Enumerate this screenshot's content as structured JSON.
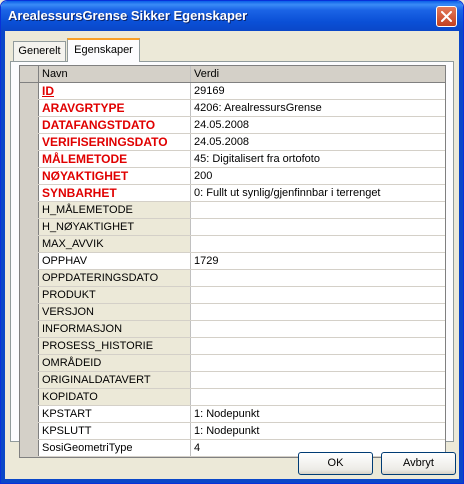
{
  "window": {
    "title": "ArealessursGrense Sikker Egenskaper"
  },
  "tabs": [
    {
      "label": "Generelt",
      "active": false
    },
    {
      "label": "Egenskaper",
      "active": true
    }
  ],
  "grid": {
    "headers": {
      "name": "Navn",
      "value": "Verdi"
    },
    "rows": [
      {
        "name": "ID",
        "value": "29169",
        "required": true,
        "underline": true
      },
      {
        "name": "ARAVGRTYPE",
        "value": "4206: ArealressursGrense",
        "required": true
      },
      {
        "name": "DATAFANGSTDATO",
        "value": "24.05.2008",
        "required": true
      },
      {
        "name": "VERIFISERINGSDATO",
        "value": "24.05.2008",
        "required": true
      },
      {
        "name": "MÅLEMETODE",
        "value": "45: Digitalisert fra ortofoto",
        "required": true
      },
      {
        "name": "NØYAKTIGHET",
        "value": "200",
        "required": true
      },
      {
        "name": "SYNBARHET",
        "value": "0: Fullt ut synlig/gjenfinnbar i terrenget",
        "required": true
      },
      {
        "name": "H_MÅLEMETODE",
        "value": ""
      },
      {
        "name": "H_NØYAKTIGHET",
        "value": ""
      },
      {
        "name": "MAX_AVVIK",
        "value": ""
      },
      {
        "name": "OPPHAV",
        "value": "1729"
      },
      {
        "name": "OPPDATERINGSDATO",
        "value": ""
      },
      {
        "name": "PRODUKT",
        "value": ""
      },
      {
        "name": "VERSJON",
        "value": ""
      },
      {
        "name": "INFORMASJON",
        "value": ""
      },
      {
        "name": "PROSESS_HISTORIE",
        "value": ""
      },
      {
        "name": "OMRÅDEID",
        "value": ""
      },
      {
        "name": "ORIGINALDATAVERT",
        "value": ""
      },
      {
        "name": "KOPIDATO",
        "value": ""
      },
      {
        "name": "KPSTART",
        "value": "1: Nodepunkt"
      },
      {
        "name": "KPSLUTT",
        "value": "1: Nodepunkt"
      },
      {
        "name": "SosiGeometriType",
        "value": "4"
      }
    ]
  },
  "buttons": {
    "ok": "OK",
    "cancel": "Avbryt"
  }
}
